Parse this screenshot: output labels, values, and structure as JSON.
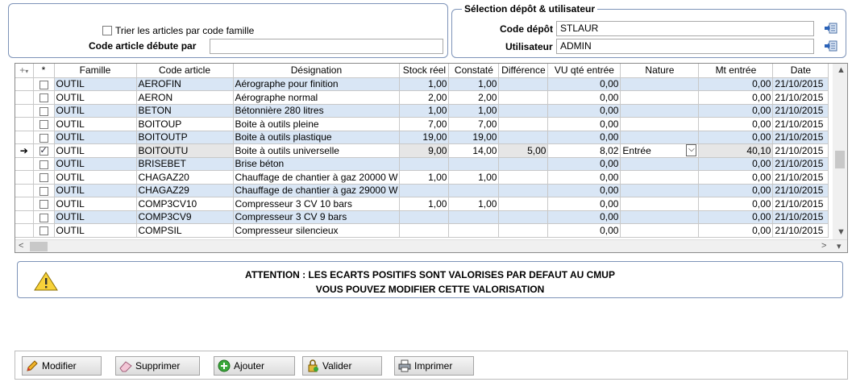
{
  "filter": {
    "sort_checkbox_label": "Trier les articles par code famille",
    "sort_checked": false,
    "code_starts_label": "Code article débute par",
    "code_starts_value": ""
  },
  "selection": {
    "legend": "Sélection dépôt & utilisateur",
    "depot_label": "Code dépôt",
    "depot_value": "STLAUR",
    "user_label": "Utilisateur",
    "user_value": "ADMIN"
  },
  "grid": {
    "columns": [
      "",
      "*",
      "Famille",
      "Code article",
      "Désignation",
      "Stock réel",
      "Constaté",
      "Différence",
      "VU qté entrée",
      "Nature",
      "Mt entrée",
      "Date"
    ],
    "rows": [
      {
        "cur": "",
        "chk": false,
        "famille": "OUTIL",
        "code": "AEROFIN",
        "designation": "Aérographe pour finition",
        "stock": "1,00",
        "constate": "1,00",
        "diff": "",
        "vu": "0,00",
        "nature": "",
        "mt": "0,00",
        "date": "21/10/2015"
      },
      {
        "cur": "",
        "chk": false,
        "famille": "OUTIL",
        "code": "AERON",
        "designation": "Aérographe normal",
        "stock": "2,00",
        "constate": "2,00",
        "diff": "",
        "vu": "0,00",
        "nature": "",
        "mt": "0,00",
        "date": "21/10/2015"
      },
      {
        "cur": "",
        "chk": false,
        "famille": "OUTIL",
        "code": "BETON",
        "designation": "Bétonnière 280 litres",
        "stock": "1,00",
        "constate": "1,00",
        "diff": "",
        "vu": "0,00",
        "nature": "",
        "mt": "0,00",
        "date": "21/10/2015"
      },
      {
        "cur": "",
        "chk": false,
        "famille": "OUTIL",
        "code": "BOITOUP",
        "designation": "Boite à outils pleine",
        "stock": "7,00",
        "constate": "7,00",
        "diff": "",
        "vu": "0,00",
        "nature": "",
        "mt": "0,00",
        "date": "21/10/2015"
      },
      {
        "cur": "",
        "chk": false,
        "famille": "OUTIL",
        "code": "BOITOUTP",
        "designation": "Boite à outils plastique",
        "stock": "19,00",
        "constate": "19,00",
        "diff": "",
        "vu": "0,00",
        "nature": "",
        "mt": "0,00",
        "date": "21/10/2015"
      },
      {
        "cur": "➔",
        "chk": true,
        "famille": "OUTIL",
        "code": "BOITOUTU",
        "designation": "Boite à outils universelle",
        "stock": "9,00",
        "constate": "14,00",
        "diff": "5,00",
        "vu": "8,02",
        "nature": "Entrée",
        "mt": "40,10",
        "date": "21/10/2015"
      },
      {
        "cur": "",
        "chk": false,
        "famille": "OUTIL",
        "code": "BRISEBET",
        "designation": "Brise béton",
        "stock": "",
        "constate": "",
        "diff": "",
        "vu": "0,00",
        "nature": "",
        "mt": "0,00",
        "date": "21/10/2015"
      },
      {
        "cur": "",
        "chk": false,
        "famille": "OUTIL",
        "code": "CHAGAZ20",
        "designation": "Chauffage de chantier à gaz 20000 W",
        "stock": "1,00",
        "constate": "1,00",
        "diff": "",
        "vu": "0,00",
        "nature": "",
        "mt": "0,00",
        "date": "21/10/2015"
      },
      {
        "cur": "",
        "chk": false,
        "famille": "OUTIL",
        "code": "CHAGAZ29",
        "designation": "Chauffage de chantier à gaz 29000 W",
        "stock": "",
        "constate": "",
        "diff": "",
        "vu": "0,00",
        "nature": "",
        "mt": "0,00",
        "date": "21/10/2015"
      },
      {
        "cur": "",
        "chk": false,
        "famille": "OUTIL",
        "code": "COMP3CV10",
        "designation": "Compresseur 3 CV 10 bars",
        "stock": "1,00",
        "constate": "1,00",
        "diff": "",
        "vu": "0,00",
        "nature": "",
        "mt": "0,00",
        "date": "21/10/2015"
      },
      {
        "cur": "",
        "chk": false,
        "famille": "OUTIL",
        "code": "COMP3CV9",
        "designation": "Compresseur 3 CV 9 bars",
        "stock": "",
        "constate": "",
        "diff": "",
        "vu": "0,00",
        "nature": "",
        "mt": "0,00",
        "date": "21/10/2015"
      },
      {
        "cur": "",
        "chk": false,
        "famille": "OUTIL",
        "code": "COMPSIL",
        "designation": "Compresseur silencieux",
        "stock": "",
        "constate": "",
        "diff": "",
        "vu": "0,00",
        "nature": "",
        "mt": "0,00",
        "date": "21/10/2015"
      }
    ]
  },
  "warning": {
    "line1": "ATTENTION : LES ECARTS POSITIFS SONT VALORISES PAR DEFAUT AU CMUP",
    "line2": "VOUS POUVEZ MODIFIER CETTE VALORISATION"
  },
  "buttons": {
    "modifier": "Modifier",
    "supprimer": "Supprimer",
    "ajouter": "Ajouter",
    "valider": "Valider",
    "imprimer": "Imprimer"
  }
}
